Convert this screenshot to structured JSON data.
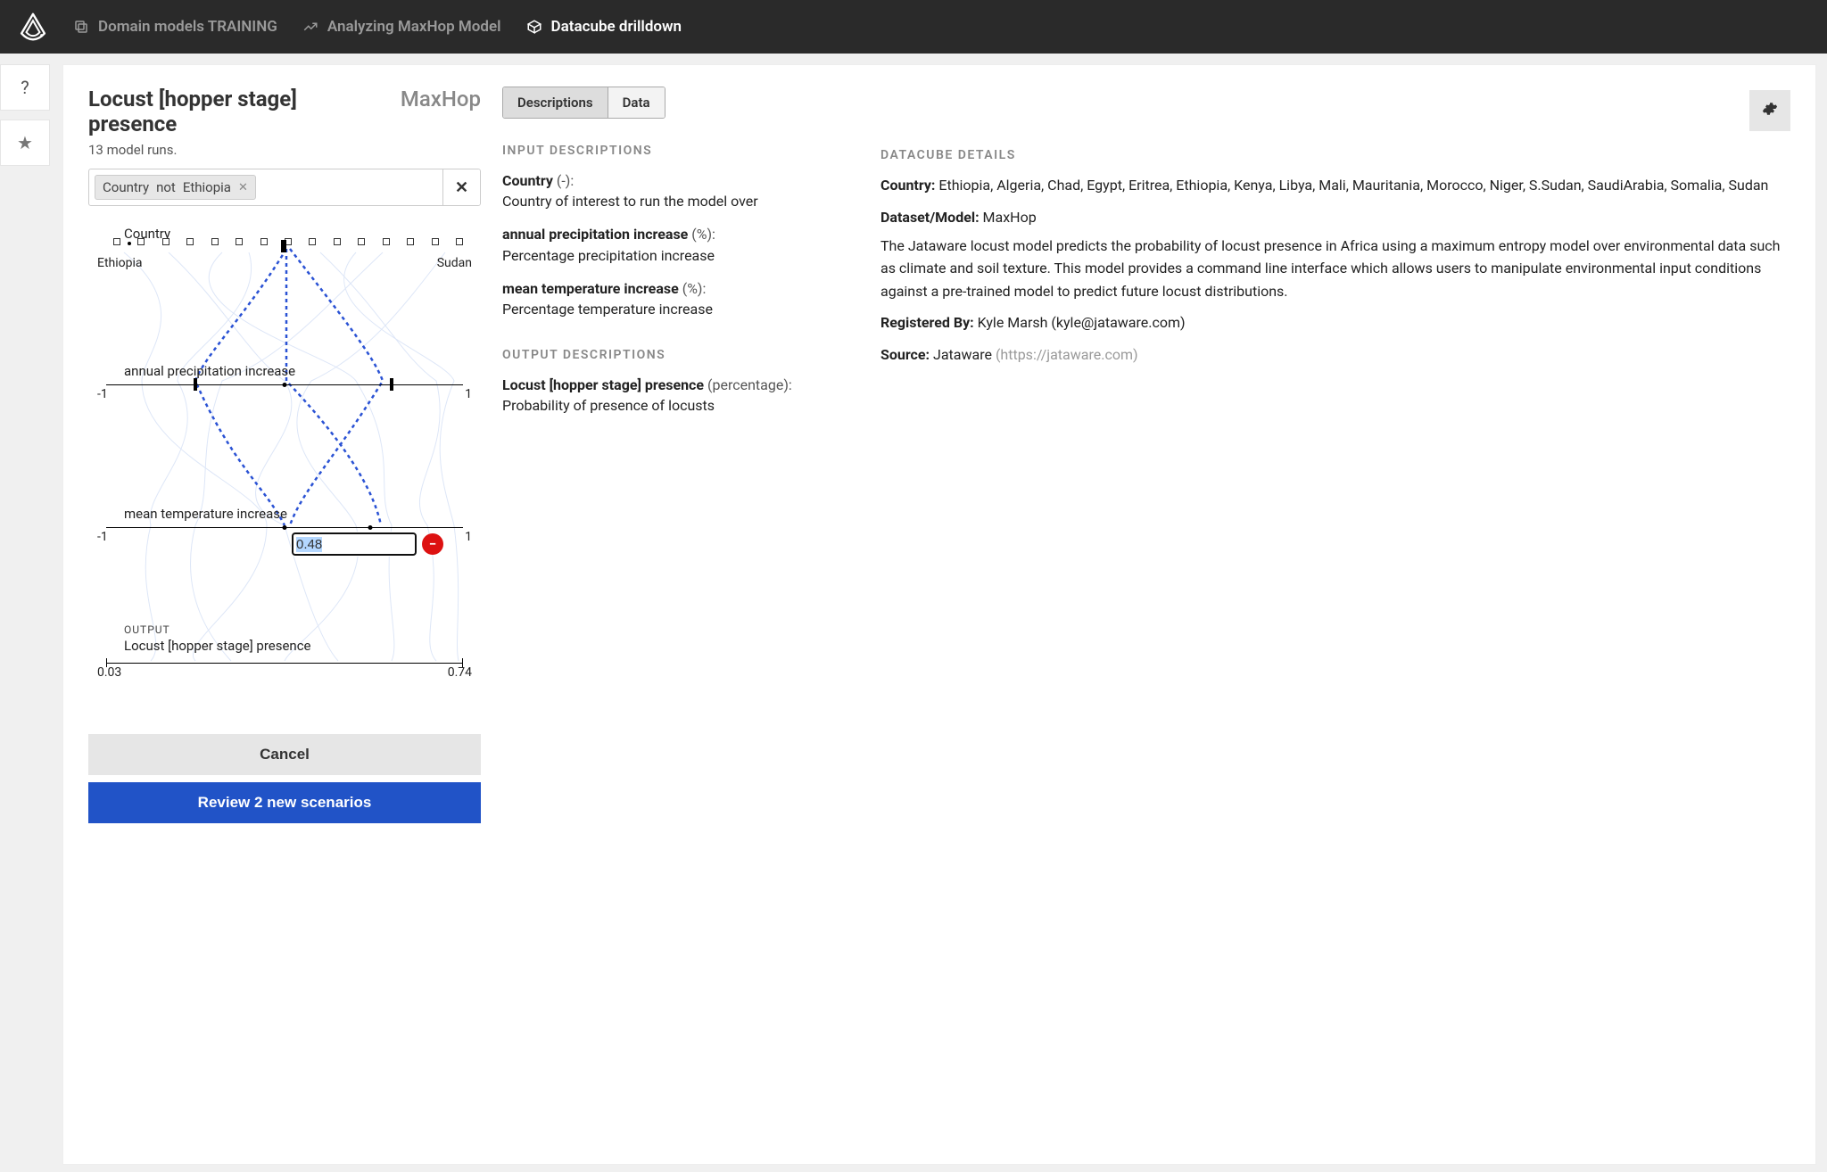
{
  "breadcrumbs": [
    {
      "label": "Domain models TRAINING",
      "icon": "copy"
    },
    {
      "label": "Analyzing MaxHop Model",
      "icon": "chart-line"
    },
    {
      "label": "Datacube drilldown",
      "icon": "cube",
      "active": true
    }
  ],
  "leftbar": {
    "help": "?",
    "star": "★"
  },
  "title": "Locust [hopper stage] presence",
  "model_name": "MaxHop",
  "runs_text": "13 model runs.",
  "filter_chip": {
    "field": "Country",
    "op": "not",
    "value": "Ethiopia"
  },
  "parallel": {
    "axis1": {
      "label": "Country",
      "left": "Ethiopia",
      "right": "Sudan",
      "tick_count": 15
    },
    "axis2": {
      "label": "annual precipitation increase",
      "left": "-1",
      "right": "1"
    },
    "axis3": {
      "label": "mean temperature increase",
      "left": "-1",
      "right": "1",
      "input_value": "0.48"
    },
    "output": {
      "header": "OUTPUT",
      "name": "Locust [hopper stage] presence",
      "left": "0.03",
      "right": "0.74"
    }
  },
  "buttons": {
    "cancel": "Cancel",
    "review": "Review 2 new scenarios"
  },
  "tabs": {
    "a": "Descriptions",
    "b": "Data"
  },
  "input_desc_header": "INPUT DESCRIPTIONS",
  "inputs": [
    {
      "name": "Country",
      "unit": "(-):",
      "desc": "Country of interest to run the model over"
    },
    {
      "name": "annual precipitation increase",
      "unit": "(%):",
      "desc": "Percentage precipitation increase"
    },
    {
      "name": "mean temperature increase",
      "unit": "(%):",
      "desc": "Percentage temperature increase"
    }
  ],
  "output_desc_header": "OUTPUT DESCRIPTIONS",
  "output_desc": {
    "name": "Locust [hopper stage] presence",
    "unit": "(percentage):",
    "desc": "Probability of presence of locusts"
  },
  "details_header": "DATACUBE DETAILS",
  "details": {
    "country_label": "Country:",
    "country_list": "Ethiopia, Algeria, Chad, Egypt, Eritrea, Ethiopia, Kenya, Libya, Mali, Mauritania, Morocco, Niger, S.Sudan, SaudiArabia, Somalia, Sudan",
    "ds_label": "Dataset/Model:",
    "ds_value": "MaxHop",
    "model_desc": "The Jataware locust model predicts the probability of locust presence in Africa using a maximum entropy model over environmental data such as climate and soil texture. This model provides a command line interface which allows users to manipulate environmental input conditions against a pre-trained model to predict future locust distributions.",
    "reg_label": "Registered By:",
    "reg_value": "Kyle Marsh (kyle@jataware.com)",
    "src_label": "Source:",
    "src_value": "Jataware",
    "src_url": "(https://jataware.com)"
  },
  "chart_data": {
    "type": "parallel-coordinates",
    "axes": [
      {
        "name": "Country",
        "type": "categorical",
        "categories_count": 15,
        "left_label": "Ethiopia",
        "right_label": "Sudan"
      },
      {
        "name": "annual precipitation increase",
        "type": "numeric",
        "range": [
          -1,
          1
        ],
        "highlighted_points": [
          -0.5,
          0,
          0.6
        ]
      },
      {
        "name": "mean temperature increase",
        "type": "numeric",
        "range": [
          -1,
          1
        ],
        "highlighted_points": [
          0,
          0.48
        ]
      },
      {
        "name": "Locust [hopper stage] presence",
        "type": "numeric",
        "range": [
          0.03,
          0.74
        ],
        "role": "output"
      }
    ],
    "highlighted_runs": 2,
    "background_runs": 13,
    "note": "Two dotted blue polylines are highlighted; remaining ~11 runs shown as faint background curves."
  }
}
